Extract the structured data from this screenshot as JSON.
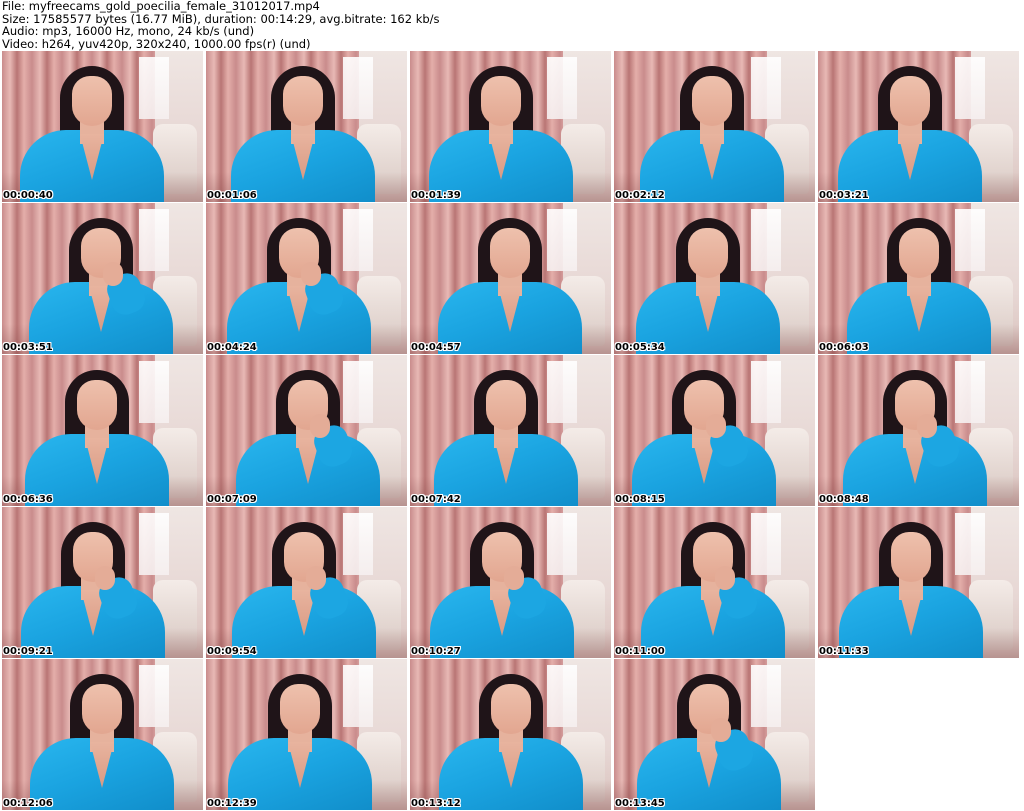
{
  "header": {
    "file_line": "File: myfreecams_gold_poecilia_female_31012017.mp4",
    "size_line": "Size: 17585577 bytes (16.77 MiB), duration: 00:14:29, avg.bitrate: 162 kb/s",
    "audio_line": "Audio: mp3, 16000 Hz, mono, 24 kb/s (und)",
    "video_line": "Video: h264, yuv420p, 320x240, 1000.00 fps(r) (und)"
  },
  "thumbnails": [
    {
      "timestamp": "00:00:40",
      "pose": "smile"
    },
    {
      "timestamp": "00:01:06",
      "pose": "smile"
    },
    {
      "timestamp": "00:01:39",
      "pose": "smile"
    },
    {
      "timestamp": "00:02:12",
      "pose": "smile"
    },
    {
      "timestamp": "00:03:21",
      "pose": "smile"
    },
    {
      "timestamp": "00:03:51",
      "pose": "hand-on-chin"
    },
    {
      "timestamp": "00:04:24",
      "pose": "hand-on-chin"
    },
    {
      "timestamp": "00:04:57",
      "pose": "smile"
    },
    {
      "timestamp": "00:05:34",
      "pose": "smile"
    },
    {
      "timestamp": "00:06:03",
      "pose": "smile"
    },
    {
      "timestamp": "00:06:36",
      "pose": "smile"
    },
    {
      "timestamp": "00:07:09",
      "pose": "hand-on-chin"
    },
    {
      "timestamp": "00:07:42",
      "pose": "smile"
    },
    {
      "timestamp": "00:08:15",
      "pose": "hand-on-chin"
    },
    {
      "timestamp": "00:08:48",
      "pose": "hand-on-chin"
    },
    {
      "timestamp": "00:09:21",
      "pose": "hand-on-chin"
    },
    {
      "timestamp": "00:09:54",
      "pose": "hand-on-chin"
    },
    {
      "timestamp": "00:10:27",
      "pose": "hand-on-chin"
    },
    {
      "timestamp": "00:11:00",
      "pose": "hand-on-chin"
    },
    {
      "timestamp": "00:11:33",
      "pose": "smile"
    },
    {
      "timestamp": "00:12:06",
      "pose": "smile"
    },
    {
      "timestamp": "00:12:39",
      "pose": "smile"
    },
    {
      "timestamp": "00:13:12",
      "pose": "smile"
    },
    {
      "timestamp": "00:13:45",
      "pose": "hand-on-chin"
    }
  ],
  "colors": {
    "background": "#ffffff",
    "robe": "#1aa3e0",
    "curtain": "#c98c8c",
    "hair": "#1f1418",
    "text": "#000000"
  }
}
